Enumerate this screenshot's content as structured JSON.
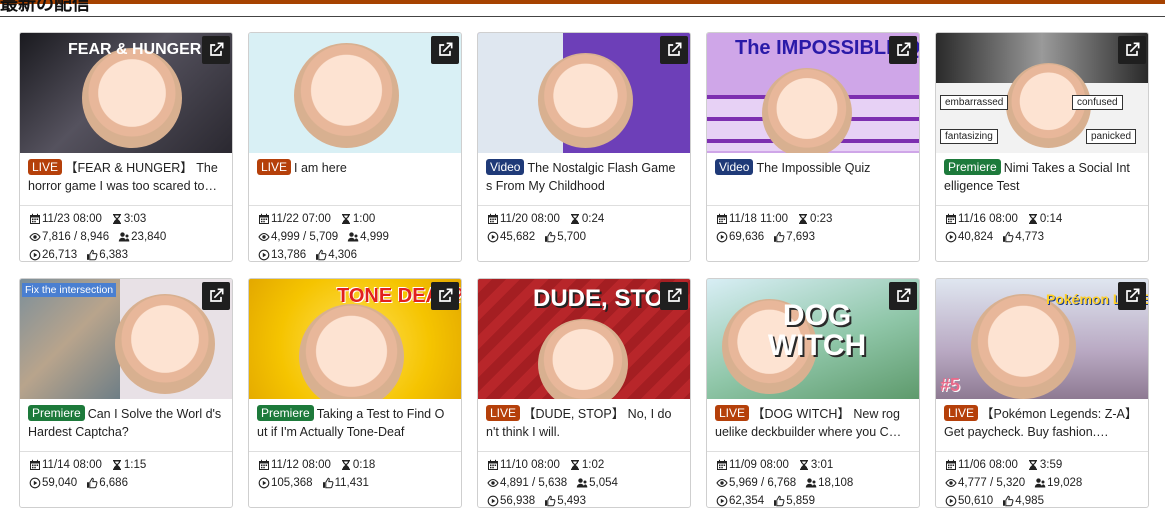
{
  "section_title": "最新の配信",
  "colors": {
    "accent": "#a64200",
    "live": "#b5400a",
    "video": "#1f3a78",
    "premiere": "#1d7a3b"
  },
  "icons": {
    "open": "external-link-icon",
    "date": "calendar-icon",
    "duration": "hourglass-icon",
    "viewers": "eye-icon",
    "unique": "users-icon",
    "plays": "play-circle-icon",
    "likes": "thumbs-up-icon"
  },
  "cards": [
    {
      "badge": "LIVE",
      "title": "【FEAR & HUNGER】 The horror game I was too scared to…",
      "thumb_text": "FEAR & HUNGER",
      "thumb_bg": "#3c3c44",
      "date": "11/23 08:00",
      "duration": "3:03",
      "viewers": "7,816 / 8,946",
      "unique": "23,840",
      "plays": "26,713",
      "likes": "6,383"
    },
    {
      "badge": "LIVE",
      "title": "I am here",
      "thumb_text": "",
      "thumb_bg": "#d9f0f5",
      "date": "11/22 07:00",
      "duration": "1:00",
      "viewers": "4,999 / 5,709",
      "unique": "4,999",
      "plays": "13,786",
      "likes": "4,306"
    },
    {
      "badge": "Video",
      "title": "The Nostalgic Flash Game s From My Childhood",
      "thumb_text": "",
      "thumb_bg": "#8a5ad2",
      "date": "11/20 08:00",
      "duration": "0:24",
      "viewers": "",
      "unique": "",
      "plays": "45,682",
      "likes": "5,700"
    },
    {
      "badge": "Video",
      "title": "The Impossible Quiz",
      "thumb_text": "The IMPOSSIBLE QUIZ",
      "thumb_bg": "#cfa6e8",
      "date": "11/18 11:00",
      "duration": "0:23",
      "viewers": "",
      "unique": "",
      "plays": "69,636",
      "likes": "7,693"
    },
    {
      "badge": "Premiere",
      "title": "Nimi Takes a Social Int elligence Test",
      "thumb_text": "",
      "thumb_bg": "#8e8e8e",
      "date": "11/16 08:00",
      "duration": "0:14",
      "viewers": "",
      "unique": "",
      "plays": "40,824",
      "likes": "4,773",
      "tags": [
        "embarrassed",
        "confused",
        "fantasizing",
        "panicked"
      ]
    },
    {
      "badge": "Premiere",
      "title": "Can I Solve the Worl d's Hardest Captcha?",
      "thumb_text": "Fix the intersection",
      "thumb_bg": "#e8e1e6",
      "date": "11/14 08:00",
      "duration": "1:15",
      "viewers": "",
      "unique": "",
      "plays": "59,040",
      "likes": "6,686"
    },
    {
      "badge": "Premiere",
      "title": "Taking a Test to Find O ut if I'm Actually Tone-Deaf",
      "thumb_text": "TONE DEAF?",
      "thumb_bg": "#f5c400",
      "date": "11/12 08:00",
      "duration": "0:18",
      "viewers": "",
      "unique": "",
      "plays": "105,368",
      "likes": "11,431"
    },
    {
      "badge": "LIVE",
      "title": "【DUDE, STOP】 No, I do n't think I will.",
      "thumb_text": "DUDE, STOP",
      "thumb_bg": "#b8262a",
      "date": "11/10 08:00",
      "duration": "1:02",
      "viewers": "4,891 / 5,638",
      "unique": "5,054",
      "plays": "56,938",
      "likes": "5,493"
    },
    {
      "badge": "LIVE",
      "title": "【DOG WITCH】 New rog uelike deckbuilder where you C…",
      "thumb_text": "DOG WITCH",
      "thumb_bg": "#9cc7b8",
      "date": "11/09 08:00",
      "duration": "3:01",
      "viewers": "5,969 / 6,768",
      "unique": "18,108",
      "plays": "62,354",
      "likes": "5,859"
    },
    {
      "badge": "LIVE",
      "title": "【Pokémon Legends: Z-A】 Get paycheck. Buy fashion.…",
      "thumb_text": "Pokémon LEGENDS",
      "thumb_bg": "#c7b6c8",
      "date": "11/06 08:00",
      "duration": "3:59",
      "viewers": "4,777 / 5,320",
      "unique": "19,028",
      "plays": "50,610",
      "likes": "4,985",
      "corner_label": "#5"
    }
  ]
}
